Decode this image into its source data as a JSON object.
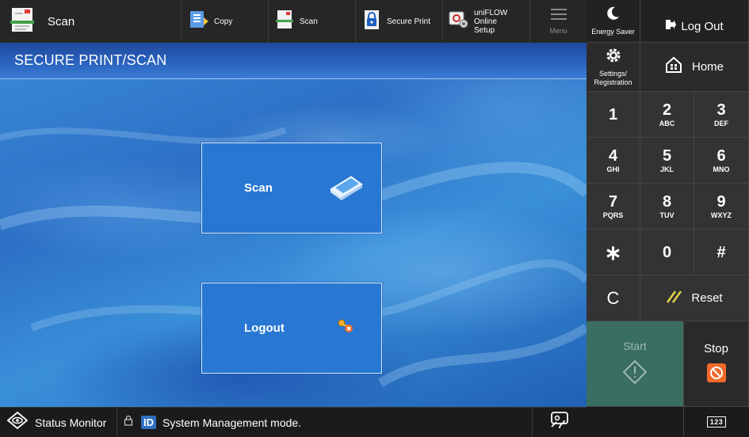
{
  "topbar": {
    "scan_label": "Scan",
    "copy_label": "Copy",
    "scan_small_label": "Scan",
    "secure_print_label": "Secure Print",
    "uniflow_label_1": "uniFLOW Online",
    "uniflow_label_2": "Setup",
    "menu_label": "Menu"
  },
  "panel": {
    "energy_saver": "Energy Saver",
    "log_out": "Log Out",
    "settings_1": "Settings/",
    "settings_2": "Registration",
    "home": "Home",
    "keys": [
      {
        "d": "1",
        "s": ""
      },
      {
        "d": "2",
        "s": "ABC"
      },
      {
        "d": "3",
        "s": "DEF"
      },
      {
        "d": "4",
        "s": "GHI"
      },
      {
        "d": "5",
        "s": "JKL"
      },
      {
        "d": "6",
        "s": "MNO"
      },
      {
        "d": "7",
        "s": "PQRS"
      },
      {
        "d": "8",
        "s": "TUV"
      },
      {
        "d": "9",
        "s": "WXYZ"
      },
      {
        "d": "∗",
        "s": ""
      },
      {
        "d": "0",
        "s": ""
      },
      {
        "d": "#",
        "s": ""
      }
    ],
    "clear": "C",
    "reset": "Reset",
    "start": "Start",
    "stop": "Stop",
    "keyboard": "123"
  },
  "main": {
    "title": "SECURE PRINT/SCAN",
    "scan_button": "Scan",
    "logout_button": "Logout"
  },
  "status": {
    "status_monitor": "Status Monitor",
    "id_badge": "ID",
    "message": "System Management mode."
  },
  "colors": {
    "accent_blue": "#2777d3",
    "start_green": "#3a6e62",
    "stop_orange": "#f06a2a",
    "reset_yellow": "#e8d84a"
  }
}
